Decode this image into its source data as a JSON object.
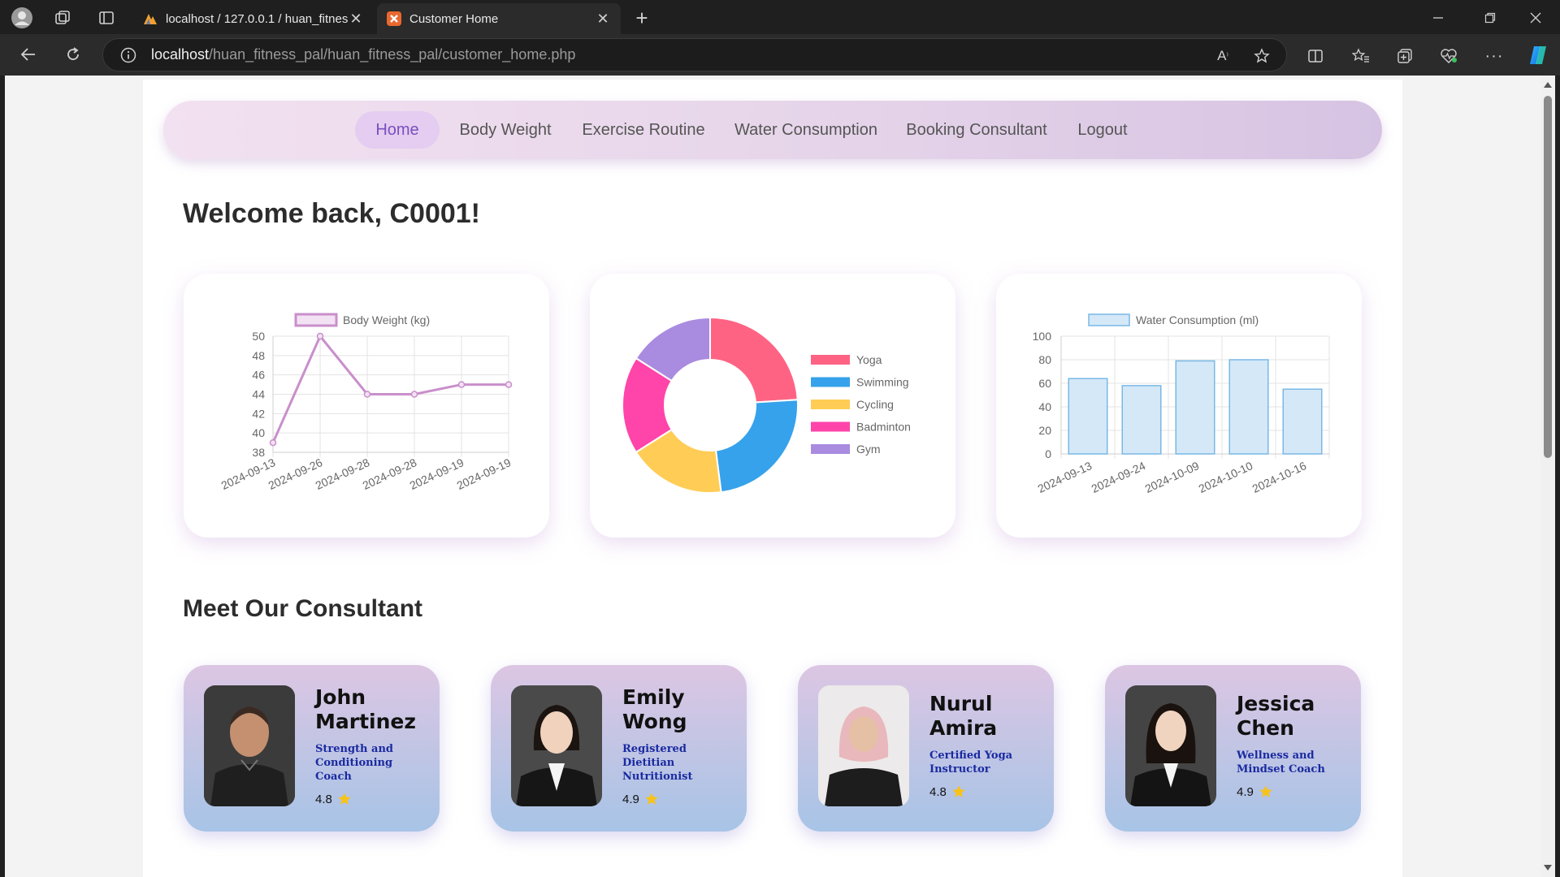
{
  "browser": {
    "tabs": [
      {
        "title": "localhost / 127.0.0.1 / huan_fitness_pal",
        "active": false
      },
      {
        "title": "Customer Home",
        "active": true
      }
    ],
    "url_host": "localhost",
    "url_path": "/huan_fitness_pal/huan_fitness_pal/customer_home.php",
    "icons": {
      "profile": "profile-icon",
      "workspaces": "workspaces-icon",
      "tab_actions": "tab-actions-icon",
      "new_tab": "plus-icon",
      "minimize": "minimize-icon",
      "restore": "restore-icon",
      "close": "close-icon",
      "back": "back-arrow-icon",
      "refresh": "refresh-icon",
      "site_info": "info-icon",
      "read_aloud": "read-aloud-icon",
      "favorite": "star-icon",
      "split_screen": "split-screen-icon",
      "favorites": "favorites-icon",
      "collections": "collections-icon",
      "health": "heart-pulse-icon",
      "more": "more-icon",
      "copilot": "copilot-icon"
    }
  },
  "nav": {
    "items": [
      {
        "label": "Home",
        "active": true
      },
      {
        "label": "Body Weight",
        "active": false
      },
      {
        "label": "Exercise Routine",
        "active": false
      },
      {
        "label": "Water Consumption",
        "active": false
      },
      {
        "label": "Booking Consultant",
        "active": false
      },
      {
        "label": "Logout",
        "active": false
      }
    ]
  },
  "welcome": "Welcome back, C0001!",
  "consultants_title": "Meet Our Consultant",
  "consultants": [
    {
      "name": "John Martinez",
      "role": "Strength and Conditioning Coach",
      "rating": "4.8"
    },
    {
      "name": "Emily Wong",
      "role": "Registered Dietitian Nutritionist",
      "rating": "4.9"
    },
    {
      "name": "Nurul Amira",
      "role": "Certified Yoga Instructor",
      "rating": "4.8"
    },
    {
      "name": "Jessica Chen",
      "role": "Wellness and Mindset Coach",
      "rating": "4.9"
    }
  ],
  "colors": {
    "weight_line": "#c98fcb",
    "water_bar_fill": "#d4e8f8",
    "water_bar_stroke": "#7ab8e4",
    "donut": [
      "#ff6384",
      "#36a2eb",
      "#ffcd56",
      "#ff44aa",
      "#a98be0"
    ],
    "star": "#f7c21a"
  },
  "chart_data": [
    {
      "type": "line",
      "series": [
        {
          "name": "Body Weight (kg)",
          "values": [
            39,
            50,
            44,
            44,
            45,
            45
          ]
        }
      ],
      "x": [
        "2024-09-13",
        "2024-09-26",
        "2024-09-28",
        "2024-09-28",
        "2024-09-19",
        "2024-09-19"
      ],
      "ylim": [
        38,
        50
      ],
      "yticks": [
        50,
        48,
        46,
        44,
        42,
        40,
        38
      ],
      "grid": true,
      "legend": "top"
    },
    {
      "type": "pie",
      "donut": true,
      "categories": [
        "Yoga",
        "Swimming",
        "Cycling",
        "Badminton",
        "Gym"
      ],
      "values": [
        24,
        24,
        18,
        18,
        16
      ],
      "legend": "right"
    },
    {
      "type": "bar",
      "series": [
        {
          "name": "Water Consumption (ml)",
          "values": [
            64,
            58,
            79,
            80,
            55
          ]
        }
      ],
      "categories": [
        "2024-09-13",
        "2024-09-24",
        "2024-10-09",
        "2024-10-10",
        "2024-10-16"
      ],
      "ylim": [
        0,
        100
      ],
      "yticks": [
        100,
        80,
        60,
        40,
        20,
        0
      ],
      "grid": true,
      "legend": "top"
    }
  ]
}
